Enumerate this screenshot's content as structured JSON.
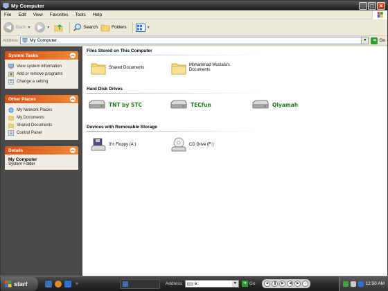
{
  "window": {
    "title": "My Computer"
  },
  "menu": [
    "File",
    "Edit",
    "View",
    "Favorites",
    "Tools",
    "Help"
  ],
  "toolbar": {
    "back": "Back",
    "search": "Search",
    "folders": "Folders"
  },
  "address": {
    "label": "Address",
    "value": "My Computer",
    "go": "Go"
  },
  "sidebar": {
    "system_tasks": {
      "title": "System Tasks",
      "items": [
        "View system information",
        "Add or remove programs",
        "Change a setting"
      ]
    },
    "other_places": {
      "title": "Other Places",
      "items": [
        "My Network Places",
        "My Documents",
        "Shared Documents",
        "Control Panel"
      ]
    },
    "details": {
      "title": "Details",
      "name": "My Computer",
      "type": "System Folder"
    }
  },
  "sections": {
    "files": {
      "title": "Files Stored on This Computer",
      "items": [
        "Shared Documents",
        "Mohammad Mustafa's Documents"
      ]
    },
    "drives": {
      "title": "Hard Disk Drives",
      "items": [
        "TNT by STC",
        "TECfun",
        "Qiyamah"
      ]
    },
    "removable": {
      "title": "Devices with Removable Storage",
      "items": [
        "3½ Floppy (A:)",
        "CD Drive (F:)"
      ]
    }
  },
  "taskbar": {
    "start": "start",
    "address_label": "Address",
    "address_value": "e:",
    "go": "Go",
    "clock": "12:50 AM"
  },
  "colors": {
    "panel_header": "#e0642a",
    "sidebar_bg": "#4a4a4a",
    "drive_label": "#1a7a1a"
  }
}
